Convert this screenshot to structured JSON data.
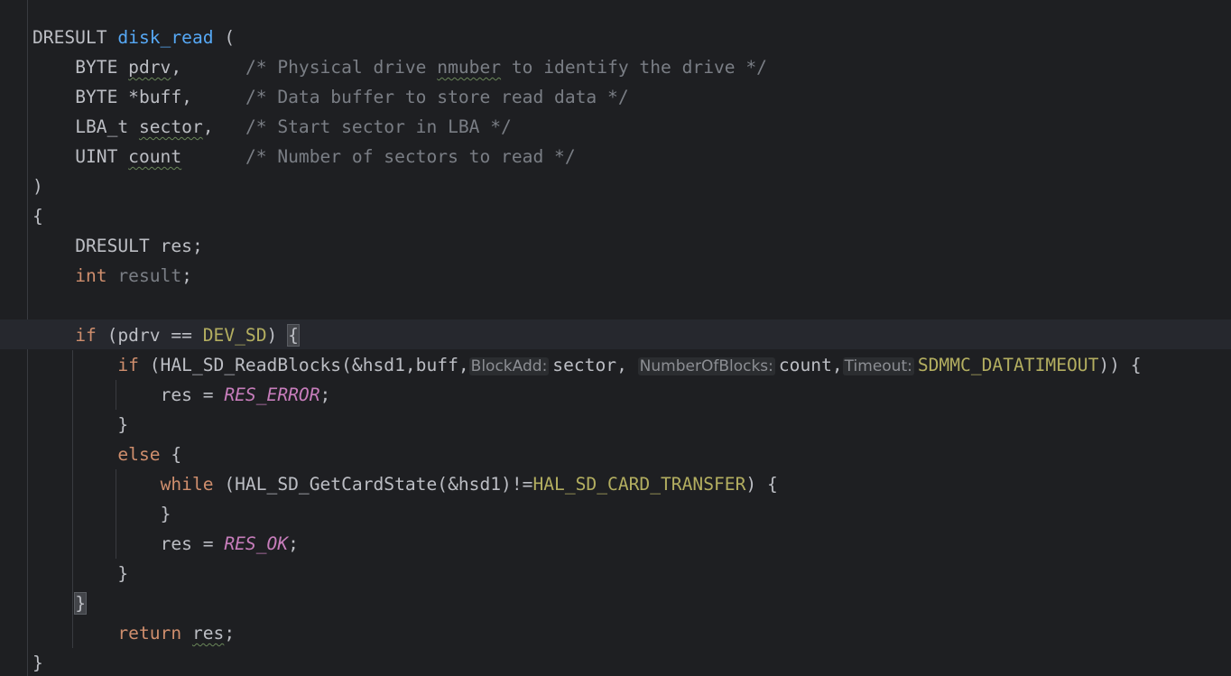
{
  "editor": {
    "language": "C",
    "lines": {
      "l1": {
        "type": "DRESULT",
        "fn": "disk_read",
        "paren": " ("
      },
      "l2": {
        "type": "BYTE",
        "param": "pdrv",
        "punct": ",",
        "comment_a": "/* Physical drive ",
        "comment_typo": "nmuber",
        "comment_b": " to identify the drive */"
      },
      "l3": {
        "type": "BYTE",
        "param": "*buff,",
        "comment": "/* Data buffer to store read data */"
      },
      "l4": {
        "type": "LBA_t",
        "param": "sector",
        "punct": ",",
        "comment": "/* Start sector in LBA */"
      },
      "l5": {
        "type": "UINT",
        "param": "count",
        "comment": "/* Number of sectors to read */"
      },
      "l6": {
        "text": ")"
      },
      "l7": {
        "text": "{"
      },
      "l8": {
        "text": "DRESULT res;"
      },
      "l9": {
        "kw": "int",
        "var": "result",
        "punct": ";"
      },
      "l11": {
        "kw": "if",
        "pre": " (pdrv == ",
        "macro": "DEV_SD",
        "post": ") ",
        "brace": "{"
      },
      "l12": {
        "kw": "if",
        "pre": " (HAL_SD_ReadBlocks(&hsd1,buff,",
        "hint1": "BlockAdd:",
        "arg1": "sector,",
        "hint2": "NumberOfBlocks:",
        "arg2": "count,",
        "hint3": "Timeout:",
        "macro": "SDMMC_DATATIMEOUT",
        "post": ")) {"
      },
      "l13": {
        "pre": "res = ",
        "enum": "RES_ERROR",
        "post": ";"
      },
      "l14": {
        "text": "}"
      },
      "l15": {
        "kw": "else",
        "post": " {"
      },
      "l16": {
        "kw": "while",
        "pre": " (HAL_SD_GetCardState(&hsd1)!=",
        "macro": "HAL_SD_CARD_TRANSFER",
        "post": ") {"
      },
      "l17": {
        "text": "}"
      },
      "l18": {
        "pre": "res = ",
        "enum": "RES_OK",
        "post": ";"
      },
      "l19": {
        "text": "}"
      },
      "l20": {
        "brace": "}"
      },
      "l21": {
        "kw": "return",
        "sp": " ",
        "var": "res",
        "post": ";"
      },
      "l22": {
        "text": "}"
      }
    },
    "colors": {
      "background": "#1e1f22",
      "default_text": "#bcbec4",
      "keyword": "#cf8e6d",
      "function": "#56a8f5",
      "comment": "#7a7e85",
      "macro": "#b3ae60",
      "enum_constant": "#c77dbb"
    }
  }
}
